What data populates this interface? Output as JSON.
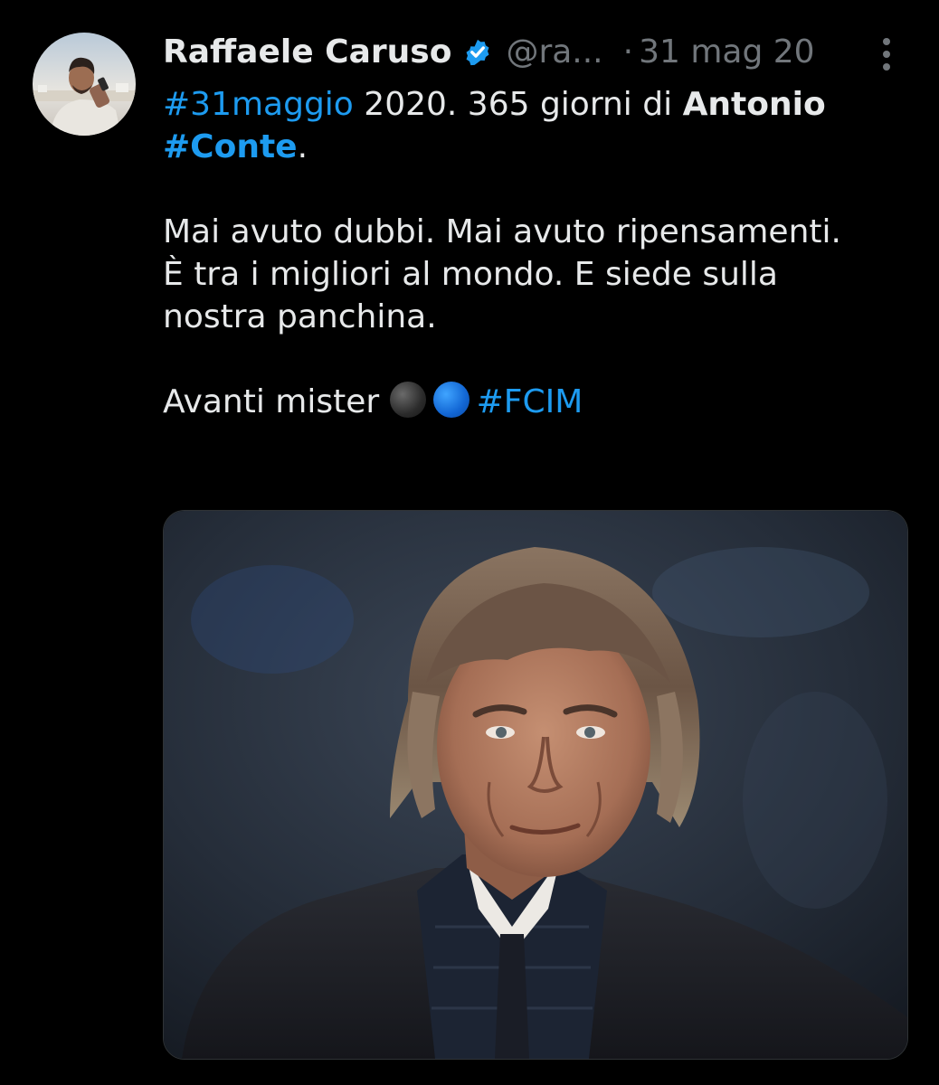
{
  "tweet": {
    "author": {
      "display_name": "Raffaele Caruso",
      "handle": "@ra...",
      "verified_icon": "verified-badge-icon",
      "avatar_icon": "profile-photo"
    },
    "separator": "·",
    "date": "31 mag 20",
    "more_icon": "more-vertical-icon",
    "text": {
      "hashtag_date": "#31maggio",
      "line1_rest": " 2020. 365 giorni di ",
      "line1_bold": "Antonio",
      "hashtag_conte": "#Conte",
      "line2_rest": ".",
      "paragraph2_line1": "Mai avuto dubbi. Mai avuto ripensamenti.",
      "paragraph2_line2": "È tra i migliori al mondo. E siede sulla",
      "paragraph2_line3": "nostra panchina.",
      "paragraph3_text": "Avanti mister ",
      "emoji1": "black-circle-emoji",
      "emoji2": "blue-circle-emoji",
      "hashtag_fcim": "#FCIM"
    },
    "media": {
      "type": "photo",
      "subject": "portrait-photo"
    }
  },
  "colors": {
    "background": "#000000",
    "text_primary": "#e7e9ea",
    "text_secondary": "#71767b",
    "link_blue": "#1d9bf0"
  }
}
